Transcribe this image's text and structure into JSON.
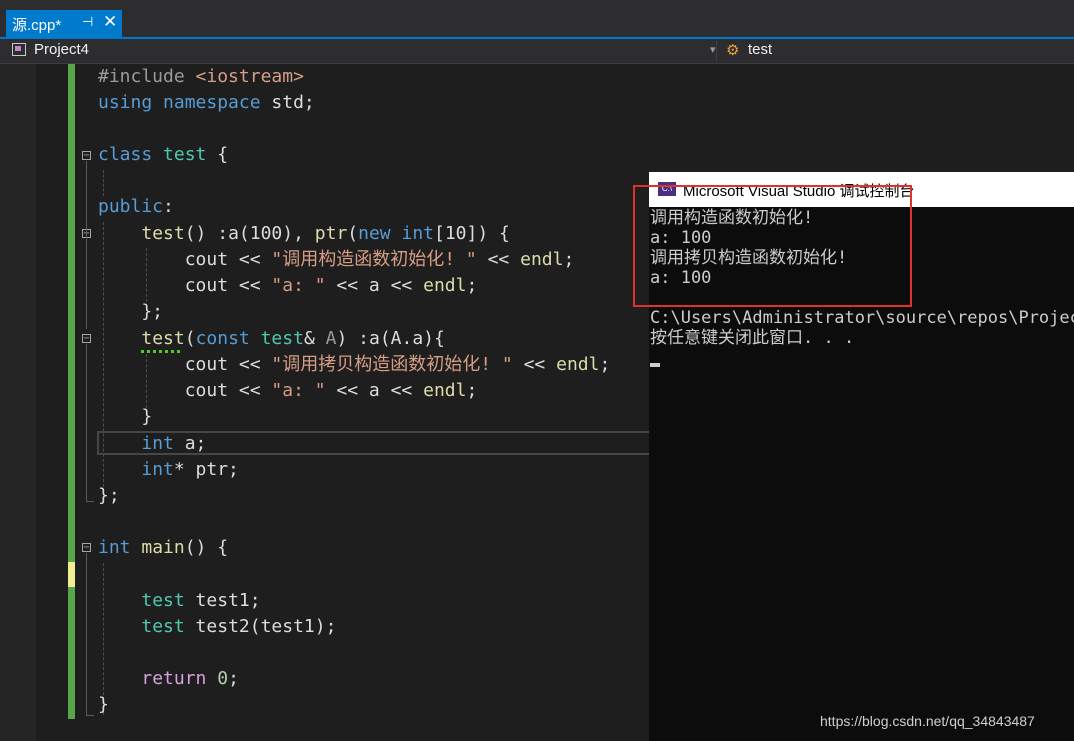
{
  "tab": {
    "file_name": "源.cpp*",
    "pin_glyph": "⊣",
    "close_glyph": "✕"
  },
  "navbar": {
    "project": "Project4",
    "dropdown_glyph": "▾",
    "member": "test",
    "member_icon": "class-icon"
  },
  "code_lines": [
    [
      {
        "t": "#include ",
        "c": "pre"
      },
      {
        "t": "<iostream>",
        "c": "inc"
      }
    ],
    [
      {
        "t": "using",
        "c": "kw"
      },
      {
        "t": " "
      },
      {
        "t": "namespace",
        "c": "kw"
      },
      {
        "t": " std;"
      }
    ],
    [],
    [
      {
        "t": "class",
        "c": "kw"
      },
      {
        "t": " "
      },
      {
        "t": "test",
        "c": "ty"
      },
      {
        "t": " {"
      }
    ],
    [],
    [
      {
        "t": "public",
        "c": "kw"
      },
      {
        "t": ":"
      }
    ],
    [
      {
        "t": "    "
      },
      {
        "t": "test",
        "c": "fn"
      },
      {
        "t": "() :a(100), "
      },
      {
        "t": "ptr",
        "c": "fn"
      },
      {
        "t": "("
      },
      {
        "t": "new",
        "c": "kw"
      },
      {
        "t": " "
      },
      {
        "t": "int",
        "c": "kw"
      },
      {
        "t": "[10]) {"
      }
    ],
    [
      {
        "t": "        cout << "
      },
      {
        "t": "\"调用构造函数初始化! \"",
        "c": "str"
      },
      {
        "t": " << "
      },
      {
        "t": "endl",
        "c": "fn"
      },
      {
        "t": ";"
      }
    ],
    [
      {
        "t": "        cout << "
      },
      {
        "t": "\"a: \"",
        "c": "str"
      },
      {
        "t": " << a << "
      },
      {
        "t": "endl",
        "c": "fn"
      },
      {
        "t": ";"
      }
    ],
    [
      {
        "t": "    };"
      }
    ],
    [
      {
        "t": "    "
      },
      {
        "t": "test",
        "c": "fn"
      },
      {
        "t": "("
      },
      {
        "t": "const",
        "c": "kw"
      },
      {
        "t": " "
      },
      {
        "t": "test",
        "c": "ty"
      },
      {
        "t": "& "
      },
      {
        "t": "A",
        "c": "par"
      },
      {
        "t": ") :a(A.a){"
      }
    ],
    [
      {
        "t": "        cout << "
      },
      {
        "t": "\"调用拷贝构造函数初始化! \"",
        "c": "str"
      },
      {
        "t": " << "
      },
      {
        "t": "endl",
        "c": "fn"
      },
      {
        "t": ";"
      }
    ],
    [
      {
        "t": "        cout << "
      },
      {
        "t": "\"a: \"",
        "c": "str"
      },
      {
        "t": " << a << "
      },
      {
        "t": "endl",
        "c": "fn"
      },
      {
        "t": ";"
      }
    ],
    [
      {
        "t": "    }"
      }
    ],
    [
      {
        "t": "    "
      },
      {
        "t": "int",
        "c": "kw"
      },
      {
        "t": " a;"
      }
    ],
    [
      {
        "t": "    "
      },
      {
        "t": "int",
        "c": "kw"
      },
      {
        "t": "* ptr;"
      }
    ],
    [
      {
        "t": "};"
      }
    ],
    [],
    [
      {
        "t": "int",
        "c": "kw"
      },
      {
        "t": " "
      },
      {
        "t": "main",
        "c": "fn"
      },
      {
        "t": "() {"
      }
    ],
    [],
    [
      {
        "t": "    "
      },
      {
        "t": "test",
        "c": "ty"
      },
      {
        "t": " test1;"
      }
    ],
    [
      {
        "t": "    "
      },
      {
        "t": "test",
        "c": "ty"
      },
      {
        "t": " test2(test1);"
      }
    ],
    [],
    [
      {
        "t": "    "
      },
      {
        "t": "return",
        "c": "ret"
      },
      {
        "t": " "
      },
      {
        "t": "0",
        "c": "num"
      },
      {
        "t": ";"
      }
    ],
    [
      {
        "t": "}"
      }
    ]
  ],
  "console": {
    "icon_text": "C:\\",
    "title": "Microsoft Visual Studio 调试控制台",
    "lines": [
      "调用构造函数初始化!",
      "a: 100",
      "调用拷贝构造函数初始化!",
      "a: 100",
      "",
      "C:\\Users\\Administrator\\source\\repos\\Project",
      "按任意键关闭此窗口. . ."
    ]
  },
  "watermark": "https://blog.csdn.net/qq_34843487",
  "colors": {
    "accent": "#007acc",
    "highlight_border": "#e0312c",
    "change_bar_green": "#57a64a",
    "change_bar_yellow": "#efef91"
  }
}
